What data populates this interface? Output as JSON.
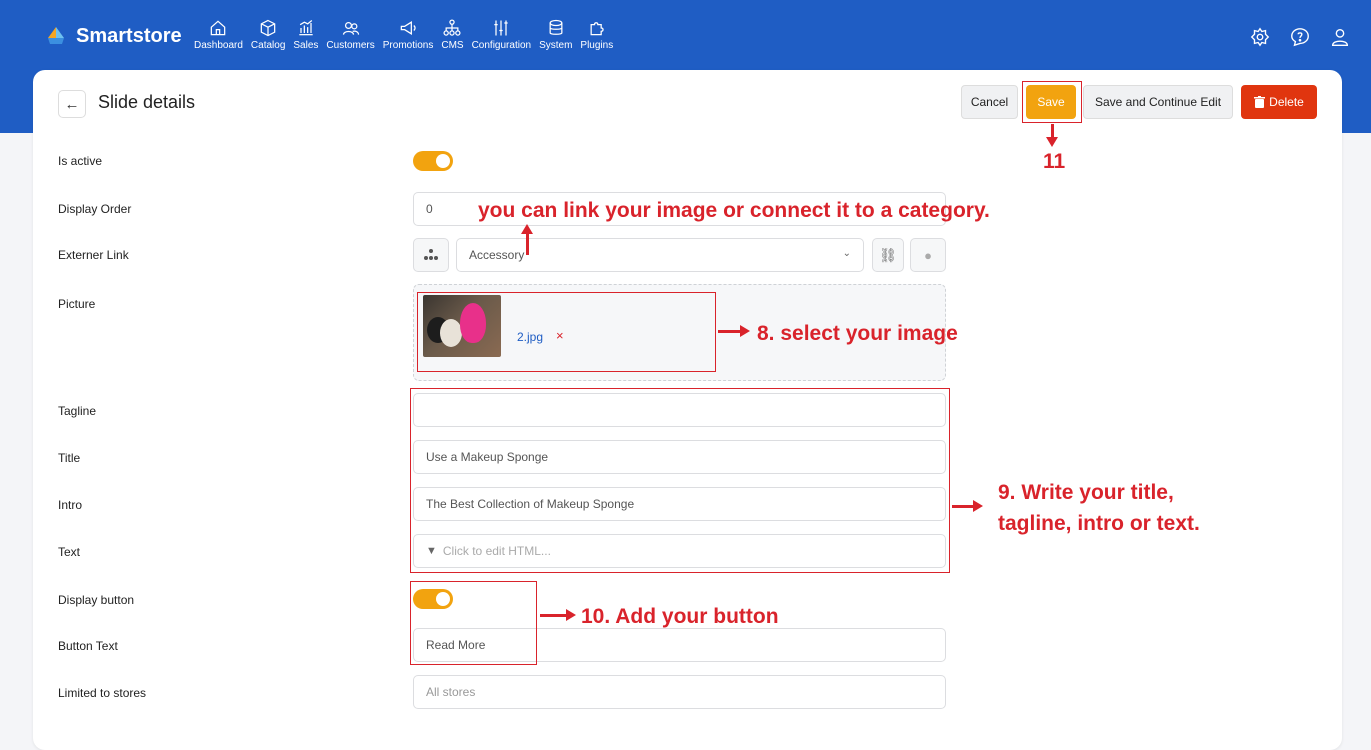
{
  "brand": {
    "name": "Smartstore"
  },
  "nav": [
    {
      "label": "Dashboard",
      "icon": "home-icon"
    },
    {
      "label": "Catalog",
      "icon": "cube-icon"
    },
    {
      "label": "Sales",
      "icon": "chart-icon"
    },
    {
      "label": "Customers",
      "icon": "users-icon"
    },
    {
      "label": "Promotions",
      "icon": "megaphone-icon"
    },
    {
      "label": "CMS",
      "icon": "sitemap-icon"
    },
    {
      "label": "Configuration",
      "icon": "sliders-icon"
    },
    {
      "label": "System",
      "icon": "database-icon"
    },
    {
      "label": "Plugins",
      "icon": "puzzle-icon"
    }
  ],
  "header": {
    "title": "Slide details",
    "cancel": "Cancel",
    "save": "Save",
    "save_continue": "Save and Continue Edit",
    "delete": "Delete"
  },
  "form": {
    "is_active_label": "Is active",
    "display_order_label": "Display Order",
    "display_order_value": "0",
    "external_link_label": "Externer Link",
    "external_link_value": "Accessory",
    "picture_label": "Picture",
    "picture_file": "2.jpg",
    "picture_remove": "×",
    "tagline_label": "Tagline",
    "tagline_value": "",
    "title_label": "Title",
    "title_value": "Use a Makeup Sponge",
    "intro_label": "Intro",
    "intro_value": "The Best Collection of  Makeup Sponge",
    "text_label": "Text",
    "text_placeholder": "Click to edit HTML...",
    "display_button_label": "Display button",
    "button_text_label": "Button Text",
    "button_text_value": "Read More",
    "limited_stores_label": "Limited to stores",
    "limited_stores_placeholder": "All stores"
  },
  "annotations": {
    "link_note": "you can link your image or connect it to a category.",
    "step8": "8. select your image",
    "step9_line1": "9. Write your title,",
    "step9_line2": "tagline, intro or text.",
    "step10": "10. Add your button",
    "step11": "11"
  },
  "colors": {
    "topbar": "#1f5dc4",
    "accent_orange": "#f2a30f",
    "delete_red": "#e0350f",
    "annotation_red": "#d9232b"
  }
}
